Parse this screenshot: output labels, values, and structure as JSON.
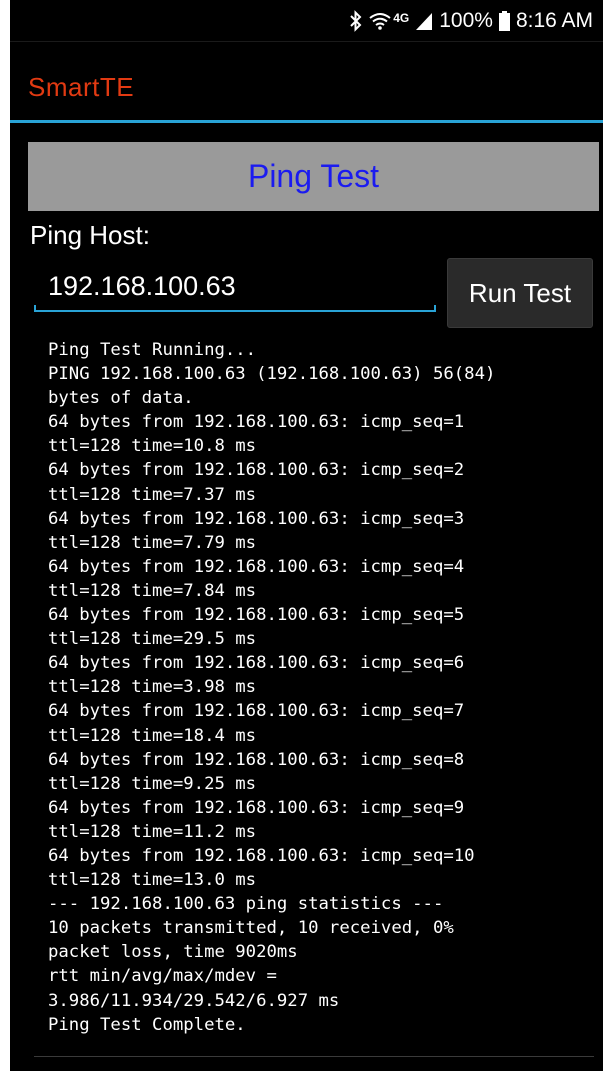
{
  "status_bar": {
    "bluetooth_icon": "bluetooth-icon",
    "wifi_icon": "wifi-icon",
    "network_label": "4G",
    "signal_icon": "signal-icon",
    "battery_percent": "100%",
    "battery_icon": "battery-icon",
    "time": "8:16 AM"
  },
  "app": {
    "title": "SmartTE",
    "title_color": "#e23a12",
    "accent_color": "#29a3d6"
  },
  "ping": {
    "header_label": "Ping Test",
    "host_label": "Ping Host:",
    "host_value": "192.168.100.63",
    "run_label": "Run Test"
  },
  "output_lines": [
    "Ping Test Running...",
    "PING 192.168.100.63 (192.168.100.63) 56(84)",
    "bytes of data.",
    "64 bytes from 192.168.100.63: icmp_seq=1",
    "ttl=128 time=10.8 ms",
    "64 bytes from 192.168.100.63: icmp_seq=2",
    "ttl=128 time=7.37 ms",
    "64 bytes from 192.168.100.63: icmp_seq=3",
    "ttl=128 time=7.79 ms",
    "64 bytes from 192.168.100.63: icmp_seq=4",
    "ttl=128 time=7.84 ms",
    "64 bytes from 192.168.100.63: icmp_seq=5",
    "ttl=128 time=29.5 ms",
    "64 bytes from 192.168.100.63: icmp_seq=6",
    "ttl=128 time=3.98 ms",
    "64 bytes from 192.168.100.63: icmp_seq=7",
    "ttl=128 time=18.4 ms",
    "64 bytes from 192.168.100.63: icmp_seq=8",
    "ttl=128 time=9.25 ms",
    "64 bytes from 192.168.100.63: icmp_seq=9",
    "ttl=128 time=11.2 ms",
    "64 bytes from 192.168.100.63: icmp_seq=10",
    "ttl=128 time=13.0 ms",
    "--- 192.168.100.63 ping statistics ---",
    "10 packets transmitted, 10 received, 0%",
    "packet loss, time 9020ms",
    "rtt min/avg/max/mdev =",
    "3.986/11.934/29.542/6.927 ms",
    "Ping Test Complete."
  ]
}
